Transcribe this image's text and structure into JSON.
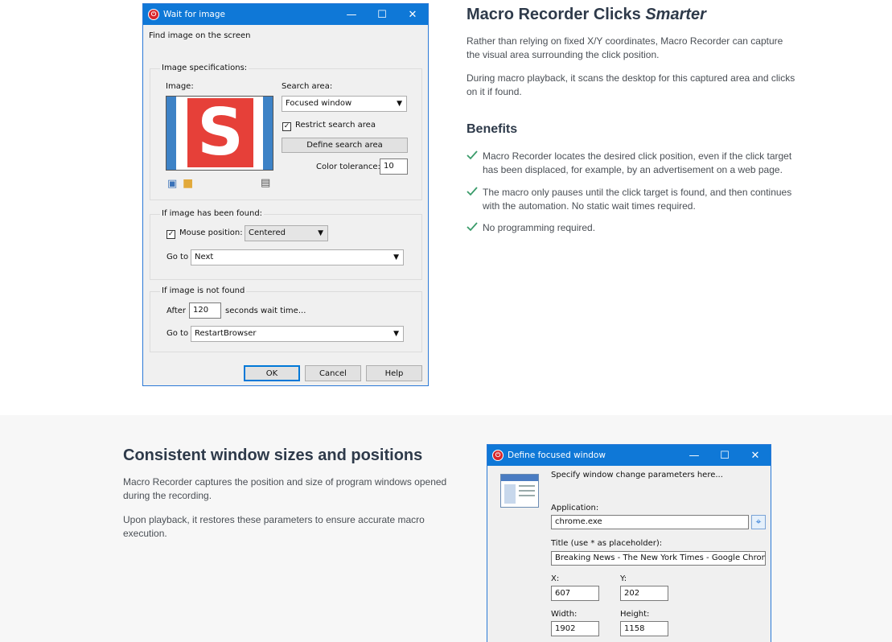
{
  "wait_dialog": {
    "title": "Wait for image",
    "subtitle": "Find image on the screen",
    "specs_legend": "Image specifications:",
    "image_label": "Image:",
    "search_area_label": "Search area:",
    "search_area_value": "Focused window",
    "restrict_label": "Restrict search area",
    "restrict_checked": true,
    "define_button": "Define search area",
    "tolerance_label": "Color tolerance:",
    "tolerance_value": "10",
    "found_legend": "If image has been found:",
    "mouse_label": "Mouse position:",
    "mouse_checked": true,
    "mouse_value": "Centered",
    "goto_label": "Go to",
    "found_goto_value": "Next",
    "notfound_legend": "If image is not found",
    "after_label": "After",
    "after_value": "120",
    "wait_label": "seconds wait time...",
    "notfound_goto_value": "RestartBrowser",
    "ok": "OK",
    "cancel": "Cancel",
    "help": "Help"
  },
  "smarter": {
    "title_plain": "Macro Recorder Clicks ",
    "title_em": "Smarter",
    "p1": "Rather than relying on fixed X/Y coordinates, Macro Recorder can capture the visual area surrounding the click position.",
    "p2": "During macro playback, it scans the desktop for this captured area and clicks on it if found.",
    "benefits_title": "Benefits",
    "benefits": [
      "Macro Recorder locates the desired click position, even if the click target has been displaced, for example, by an advertisement on a web page.",
      "The macro only pauses until the click target is found, and then continues with the automation. No static wait times required.",
      "No programming required."
    ]
  },
  "consistent": {
    "title": "Consistent window sizes and positions",
    "p1": "Macro Recorder captures the position and size of program windows opened during the recording.",
    "p2": "Upon playback, it restores these parameters to ensure accurate macro execution."
  },
  "focused_dialog": {
    "title": "Define focused window",
    "subtitle": "Specify window change parameters here...",
    "app_label": "Application:",
    "app_value": "chrome.exe",
    "title_label": "Title (use * as placeholder):",
    "title_value": "Breaking News - The New York Times - Google Chrome",
    "x_label": "X:",
    "x_value": "607",
    "y_label": "Y:",
    "y_value": "202",
    "width_label": "Width:",
    "width_value": "1902",
    "height_label": "Height:",
    "height_value": "1158"
  },
  "colors": {
    "accent": "#0f78d7",
    "check_green": "#3a9b6a",
    "heading": "#2e3a4a"
  }
}
